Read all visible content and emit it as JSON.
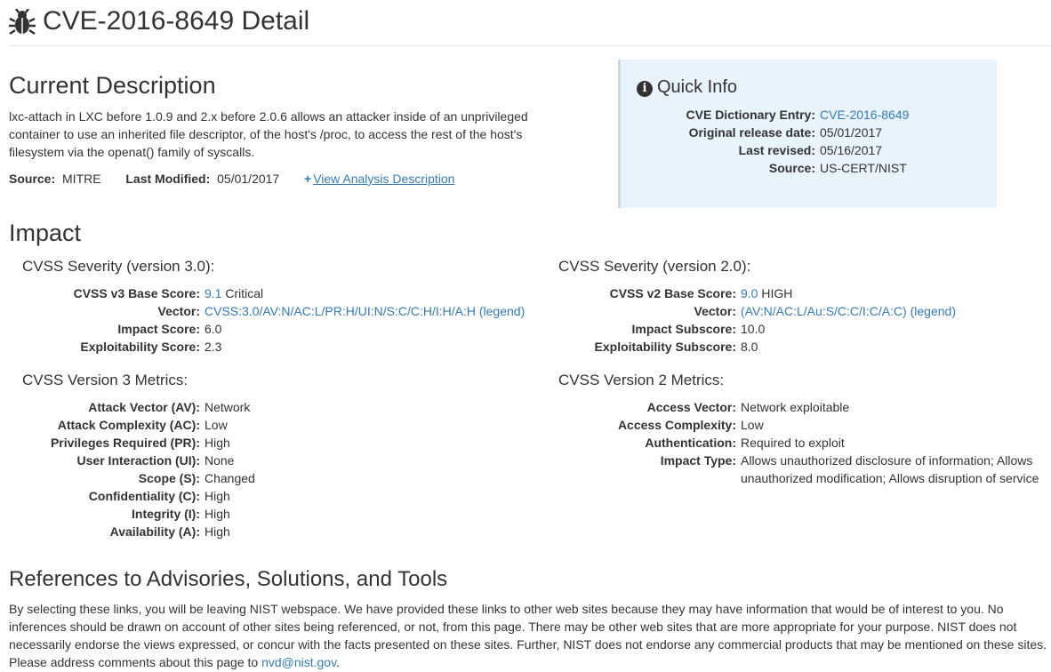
{
  "page_title": "CVE-2016-8649 Detail",
  "description": {
    "heading": "Current Description",
    "text": "lxc-attach in LXC before 1.0.9 and 2.x before 2.0.6 allows an attacker inside of an unprivileged container to use an inherited file descriptor, of the host's /proc, to access the rest of the host's filesystem via the openat() family of syscalls.",
    "source_label": "Source:",
    "source_value": "MITRE",
    "last_modified_label": "Last Modified:",
    "last_modified_value": "05/01/2017",
    "view_analysis_label": "View Analysis Description"
  },
  "quick_info": {
    "heading": "Quick Info",
    "rows": [
      {
        "label": "CVE Dictionary Entry:",
        "value": "CVE-2016-8649"
      },
      {
        "label": "Original release date:",
        "value": "05/01/2017"
      },
      {
        "label": "Last revised:",
        "value": "05/16/2017"
      },
      {
        "label": "Source:",
        "value": "US-CERT/NIST"
      }
    ]
  },
  "impact": {
    "heading": "Impact",
    "v3": {
      "heading": "CVSS Severity (version 3.0):",
      "base_label": "CVSS v3 Base Score:",
      "base_score": "9.1",
      "base_severity": "Critical",
      "vector_label": "Vector:",
      "vector_value": "CVSS:3.0/AV:N/AC:L/PR:H/UI:N/S:C/C:H/I:H/A:H",
      "legend_open": "(",
      "legend_label": "legend",
      "legend_close": ")",
      "impact_label": "Impact Score:",
      "impact_value": "6.0",
      "exploit_label": "Exploitability Score:",
      "exploit_value": "2.3"
    },
    "v2": {
      "heading": "CVSS Severity (version 2.0):",
      "base_label": "CVSS v2 Base Score:",
      "base_score": "9.0",
      "base_severity": "HIGH",
      "vector_label": "Vector:",
      "vector_value": "(AV:N/AC:L/Au:S/C:C/I:C/A:C)",
      "legend_open": "(",
      "legend_label": "legend",
      "legend_close": ")",
      "impact_label": "Impact Subscore:",
      "impact_value": "10.0",
      "exploit_label": "Exploitability Subscore:",
      "exploit_value": "8.0"
    },
    "v3_metrics": {
      "heading": "CVSS Version 3 Metrics:",
      "rows": [
        {
          "label": "Attack Vector (AV):",
          "value": "Network"
        },
        {
          "label": "Attack Complexity (AC):",
          "value": "Low"
        },
        {
          "label": "Privileges Required (PR):",
          "value": "High"
        },
        {
          "label": "User Interaction (UI):",
          "value": "None"
        },
        {
          "label": "Scope (S):",
          "value": "Changed"
        },
        {
          "label": "Confidentiality (C):",
          "value": "High"
        },
        {
          "label": "Integrity (I):",
          "value": "High"
        },
        {
          "label": "Availability (A):",
          "value": "High"
        }
      ]
    },
    "v2_metrics": {
      "heading": "CVSS Version 2 Metrics:",
      "rows": [
        {
          "label": "Access Vector:",
          "value": "Network exploitable"
        },
        {
          "label": "Access Complexity:",
          "value": "Low"
        },
        {
          "label": "Authentication:",
          "value": "Required to exploit"
        },
        {
          "label": "Impact Type:",
          "value": "Allows unauthorized disclosure of information; Allows unauthorized modification; Allows disruption of service"
        }
      ]
    }
  },
  "references": {
    "heading": "References to Advisories, Solutions, and Tools",
    "text": "By selecting these links, you will be leaving NIST webspace. We have provided these links to other web sites because they may have information that would be of interest to you. No inferences should be drawn on account of other sites being referenced, or not, from this page. There may be other web sites that are more appropriate for your purpose. NIST does not necessarily endorse the views expressed, or concur with the facts presented on these sites. Further, NIST does not endorse any commercial products that may be mentioned on these sites. Please address comments about this page to ",
    "email": "nvd@nist.gov",
    "end": "."
  },
  "icons": {
    "header": "bug-icon",
    "quick_info": "info-icon",
    "expand": "plus-icon"
  },
  "colors": {
    "link": "#337ab7",
    "quick_info_bg": "#e9f3fb",
    "text": "#333333"
  }
}
